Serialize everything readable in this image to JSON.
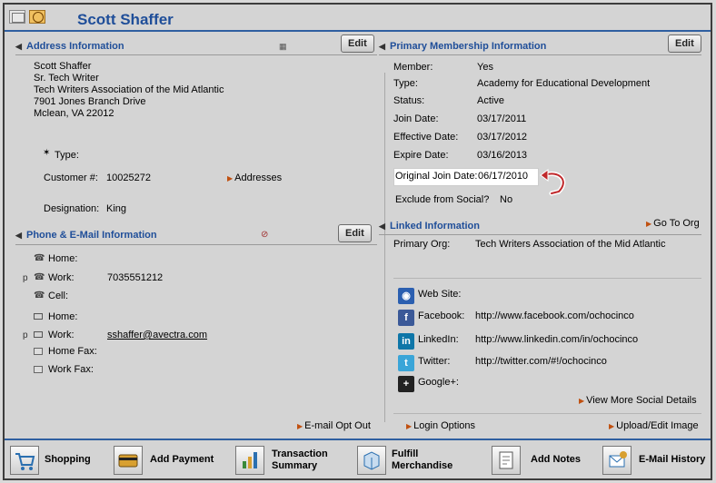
{
  "title": "Scott Shaffer",
  "address_section": {
    "heading": "Address Information",
    "edit_label": "Edit",
    "lines": [
      "Scott Shaffer",
      "Sr. Tech Writer",
      "Tech Writers Association of the Mid Atlantic",
      "7901 Jones Branch Drive",
      "Mclean, VA 22012"
    ],
    "type_label": "Type:",
    "type_value": "",
    "customer_label": "Customer #:",
    "customer_value": "10025272",
    "addresses_link": "Addresses",
    "designation_label": "Designation:",
    "designation_value": "King"
  },
  "phone_section": {
    "heading": "Phone & E-Mail Information",
    "edit_label": "Edit",
    "rows": [
      {
        "label": "Home:",
        "value": "",
        "primary": ""
      },
      {
        "label": "Work:",
        "value": "7035551212",
        "primary": "p"
      },
      {
        "label": "Cell:",
        "value": "",
        "primary": ""
      },
      {
        "label": "Home:",
        "value": "",
        "primary": ""
      },
      {
        "label": "Work:",
        "value": "sshaffer@avectra.com",
        "primary": "p"
      },
      {
        "label": "Home Fax:",
        "value": "",
        "primary": ""
      },
      {
        "label": "Work Fax:",
        "value": "",
        "primary": ""
      }
    ],
    "optout_link": "E-mail Opt Out"
  },
  "membership_section": {
    "heading": "Primary Membership Information",
    "edit_label": "Edit",
    "member_label": "Member:",
    "member_value": "Yes",
    "type_label": "Type:",
    "type_value": "Academy for Educational Development",
    "status_label": "Status:",
    "status_value": "Active",
    "join_label": "Join Date:",
    "join_value": "03/17/2011",
    "effective_label": "Effective Date:",
    "effective_value": "03/17/2012",
    "expire_label": "Expire Date:",
    "expire_value": "03/16/2013",
    "original_label": "Original Join Date:",
    "original_value": "06/17/2010",
    "exclude_label": "Exclude from Social?",
    "exclude_value": "No"
  },
  "linked_section": {
    "heading": "Linked Information",
    "goto_link": "Go To Org",
    "org_label": "Primary Org:",
    "org_value": "Tech Writers Association of the Mid Atlantic"
  },
  "social": {
    "web_label": "Web Site:",
    "web_value": "",
    "facebook_label": "Facebook:",
    "facebook_value": "http://www.facebook.com/ochocinco",
    "linkedin_label": "LinkedIn:",
    "linkedin_value": "http://www.linkedin.com/in/ochocinco",
    "twitter_label": "Twitter:",
    "twitter_value": "http://twitter.com/#!/ochocinco",
    "google_label": "Google+:",
    "google_value": "",
    "more_link": "View More Social Details",
    "login_link": "Login Options",
    "upload_link": "Upload/Edit Image"
  },
  "bottom": {
    "shopping": "Shopping",
    "add_payment": "Add Payment",
    "transaction_1": "Transaction",
    "transaction_2": "Summary",
    "fulfill_1": "Fulfill",
    "fulfill_2": "Merchandise",
    "add_notes": "Add Notes",
    "email_history": "E-Mail History"
  },
  "colors": {
    "heading": "#1f4e99",
    "link_arrow": "#c05010",
    "rule": "#2f5fa0"
  }
}
